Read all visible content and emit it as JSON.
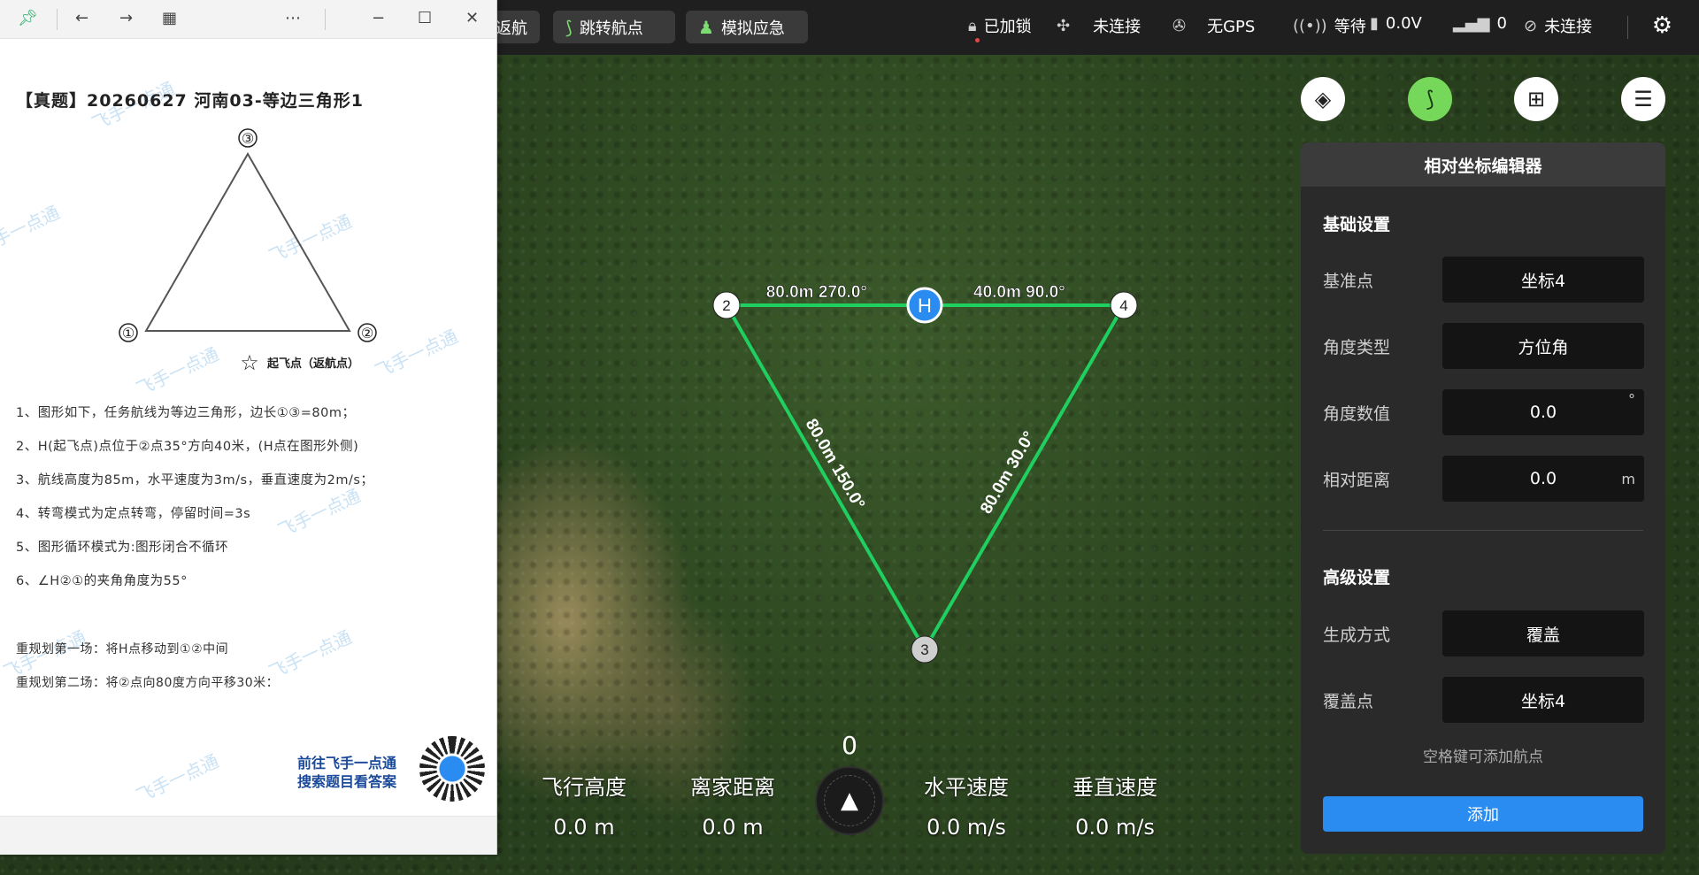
{
  "topbar": {
    "btn_return": "返航",
    "btn_jump": "跳转航点",
    "btn_emergency": "模拟应急",
    "lock_status": "已加锁",
    "link_status": "未连接",
    "gps_status": "无GPS",
    "wait_status": "等待",
    "voltage": "0.0V",
    "signal": "0",
    "conn_status": "未连接"
  },
  "map": {
    "points": [
      {
        "label": "2"
      },
      {
        "label": "4"
      },
      {
        "label": "3"
      },
      {
        "label": "H"
      }
    ],
    "edge_labels": {
      "top_left": "80.0m 270.0°",
      "top_right": "40.0m 90.0°",
      "left": "80.0m 150.0°",
      "right": "80.0m 30.0°"
    }
  },
  "panel": {
    "title": "相对坐标编辑器",
    "basic_title": "基础设置",
    "rows": [
      {
        "label": "基准点",
        "value": "坐标4",
        "unit": ""
      },
      {
        "label": "角度类型",
        "value": "方位角",
        "unit": ""
      },
      {
        "label": "角度数值",
        "value": "0.0",
        "unit": "°"
      },
      {
        "label": "相对距离",
        "value": "0.0",
        "unit": "m"
      }
    ],
    "advanced_title": "高级设置",
    "adv_rows": [
      {
        "label": "生成方式",
        "value": "覆盖"
      },
      {
        "label": "覆盖点",
        "value": "坐标4"
      }
    ],
    "hint": "空格键可添加航点",
    "add_label": "添加"
  },
  "telemetry": {
    "heading": "0",
    "altitude_label": "飞行高度",
    "altitude_value": "0.0 m",
    "home_label": "离家距离",
    "home_value": "0.0 m",
    "hspeed_label": "水平速度",
    "hspeed_value": "0.0 m/s",
    "vspeed_label": "垂直速度",
    "vspeed_value": "0.0 m/s"
  },
  "doc": {
    "title": "【真题】20260627 河南03-等边三角形1",
    "diagram": {
      "v1": "①",
      "v2": "②",
      "v3": "③",
      "takeoff": "起飞点（返航点）"
    },
    "lines": [
      "1、图形如下，任务航线为等边三角形，边长①③=80m；",
      "2、H(起飞点)点位于②点35°方向40米，(H点在图形外侧)",
      "3、航线高度为85m，水平速度为3m/s，垂直速度为2m/s；",
      "4、转弯模式为定点转弯，停留时间=3s",
      "5、图形循环模式为:图形闭合不循环",
      "6、∠H②①的夹角角度为55°"
    ],
    "replan": [
      "重规划第一场：将H点移动到①②中间",
      "重规划第二场：将②点向80度方向平移30米："
    ],
    "promo_line1": "前往飞手一点通",
    "promo_line2": "搜索题目看答案",
    "watermark": "飞手一点通"
  },
  "colors": {
    "route": "#1fd060",
    "home": "#2a8cf0",
    "accent_blue": "#2a8cf0",
    "accent_green": "#76d85a"
  }
}
